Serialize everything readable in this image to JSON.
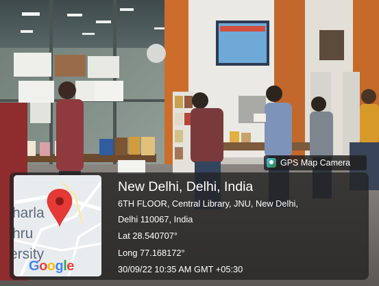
{
  "gps_badge": {
    "label": "GPS Map Camera"
  },
  "location": {
    "title": "New Delhi, Delhi, India",
    "address_line1": "6TH FLOOR, Central Library, JNU, New Delhi,",
    "address_line2": "Delhi 110067, India",
    "latitude": "Lat 28.540707°",
    "longitude": "Long 77.168172°",
    "timestamp": "30/09/22 10:35 AM GMT +05:30"
  },
  "map": {
    "fragments": [
      "harla",
      "hru",
      "ersity"
    ],
    "brand": "Google",
    "pin_color": "#e53935"
  }
}
